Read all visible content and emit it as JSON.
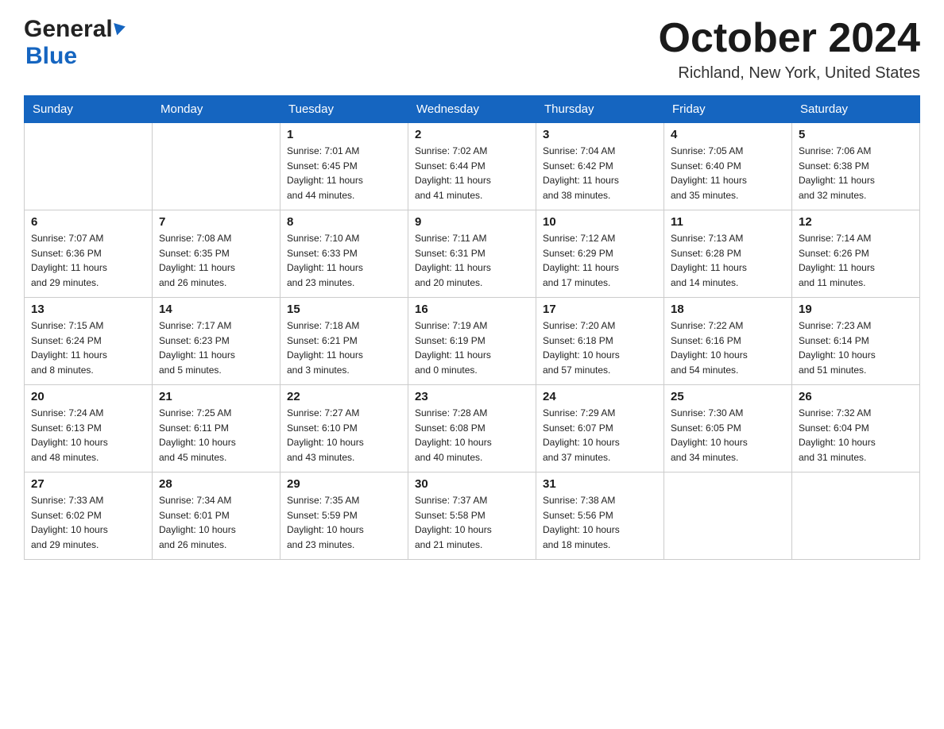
{
  "header": {
    "logo_general": "General",
    "logo_blue": "Blue",
    "month_title": "October 2024",
    "location": "Richland, New York, United States"
  },
  "calendar": {
    "days_of_week": [
      "Sunday",
      "Monday",
      "Tuesday",
      "Wednesday",
      "Thursday",
      "Friday",
      "Saturday"
    ],
    "weeks": [
      [
        {
          "day": "",
          "info": ""
        },
        {
          "day": "",
          "info": ""
        },
        {
          "day": "1",
          "info": "Sunrise: 7:01 AM\nSunset: 6:45 PM\nDaylight: 11 hours\nand 44 minutes."
        },
        {
          "day": "2",
          "info": "Sunrise: 7:02 AM\nSunset: 6:44 PM\nDaylight: 11 hours\nand 41 minutes."
        },
        {
          "day": "3",
          "info": "Sunrise: 7:04 AM\nSunset: 6:42 PM\nDaylight: 11 hours\nand 38 minutes."
        },
        {
          "day": "4",
          "info": "Sunrise: 7:05 AM\nSunset: 6:40 PM\nDaylight: 11 hours\nand 35 minutes."
        },
        {
          "day": "5",
          "info": "Sunrise: 7:06 AM\nSunset: 6:38 PM\nDaylight: 11 hours\nand 32 minutes."
        }
      ],
      [
        {
          "day": "6",
          "info": "Sunrise: 7:07 AM\nSunset: 6:36 PM\nDaylight: 11 hours\nand 29 minutes."
        },
        {
          "day": "7",
          "info": "Sunrise: 7:08 AM\nSunset: 6:35 PM\nDaylight: 11 hours\nand 26 minutes."
        },
        {
          "day": "8",
          "info": "Sunrise: 7:10 AM\nSunset: 6:33 PM\nDaylight: 11 hours\nand 23 minutes."
        },
        {
          "day": "9",
          "info": "Sunrise: 7:11 AM\nSunset: 6:31 PM\nDaylight: 11 hours\nand 20 minutes."
        },
        {
          "day": "10",
          "info": "Sunrise: 7:12 AM\nSunset: 6:29 PM\nDaylight: 11 hours\nand 17 minutes."
        },
        {
          "day": "11",
          "info": "Sunrise: 7:13 AM\nSunset: 6:28 PM\nDaylight: 11 hours\nand 14 minutes."
        },
        {
          "day": "12",
          "info": "Sunrise: 7:14 AM\nSunset: 6:26 PM\nDaylight: 11 hours\nand 11 minutes."
        }
      ],
      [
        {
          "day": "13",
          "info": "Sunrise: 7:15 AM\nSunset: 6:24 PM\nDaylight: 11 hours\nand 8 minutes."
        },
        {
          "day": "14",
          "info": "Sunrise: 7:17 AM\nSunset: 6:23 PM\nDaylight: 11 hours\nand 5 minutes."
        },
        {
          "day": "15",
          "info": "Sunrise: 7:18 AM\nSunset: 6:21 PM\nDaylight: 11 hours\nand 3 minutes."
        },
        {
          "day": "16",
          "info": "Sunrise: 7:19 AM\nSunset: 6:19 PM\nDaylight: 11 hours\nand 0 minutes."
        },
        {
          "day": "17",
          "info": "Sunrise: 7:20 AM\nSunset: 6:18 PM\nDaylight: 10 hours\nand 57 minutes."
        },
        {
          "day": "18",
          "info": "Sunrise: 7:22 AM\nSunset: 6:16 PM\nDaylight: 10 hours\nand 54 minutes."
        },
        {
          "day": "19",
          "info": "Sunrise: 7:23 AM\nSunset: 6:14 PM\nDaylight: 10 hours\nand 51 minutes."
        }
      ],
      [
        {
          "day": "20",
          "info": "Sunrise: 7:24 AM\nSunset: 6:13 PM\nDaylight: 10 hours\nand 48 minutes."
        },
        {
          "day": "21",
          "info": "Sunrise: 7:25 AM\nSunset: 6:11 PM\nDaylight: 10 hours\nand 45 minutes."
        },
        {
          "day": "22",
          "info": "Sunrise: 7:27 AM\nSunset: 6:10 PM\nDaylight: 10 hours\nand 43 minutes."
        },
        {
          "day": "23",
          "info": "Sunrise: 7:28 AM\nSunset: 6:08 PM\nDaylight: 10 hours\nand 40 minutes."
        },
        {
          "day": "24",
          "info": "Sunrise: 7:29 AM\nSunset: 6:07 PM\nDaylight: 10 hours\nand 37 minutes."
        },
        {
          "day": "25",
          "info": "Sunrise: 7:30 AM\nSunset: 6:05 PM\nDaylight: 10 hours\nand 34 minutes."
        },
        {
          "day": "26",
          "info": "Sunrise: 7:32 AM\nSunset: 6:04 PM\nDaylight: 10 hours\nand 31 minutes."
        }
      ],
      [
        {
          "day": "27",
          "info": "Sunrise: 7:33 AM\nSunset: 6:02 PM\nDaylight: 10 hours\nand 29 minutes."
        },
        {
          "day": "28",
          "info": "Sunrise: 7:34 AM\nSunset: 6:01 PM\nDaylight: 10 hours\nand 26 minutes."
        },
        {
          "day": "29",
          "info": "Sunrise: 7:35 AM\nSunset: 5:59 PM\nDaylight: 10 hours\nand 23 minutes."
        },
        {
          "day": "30",
          "info": "Sunrise: 7:37 AM\nSunset: 5:58 PM\nDaylight: 10 hours\nand 21 minutes."
        },
        {
          "day": "31",
          "info": "Sunrise: 7:38 AM\nSunset: 5:56 PM\nDaylight: 10 hours\nand 18 minutes."
        },
        {
          "day": "",
          "info": ""
        },
        {
          "day": "",
          "info": ""
        }
      ]
    ]
  }
}
